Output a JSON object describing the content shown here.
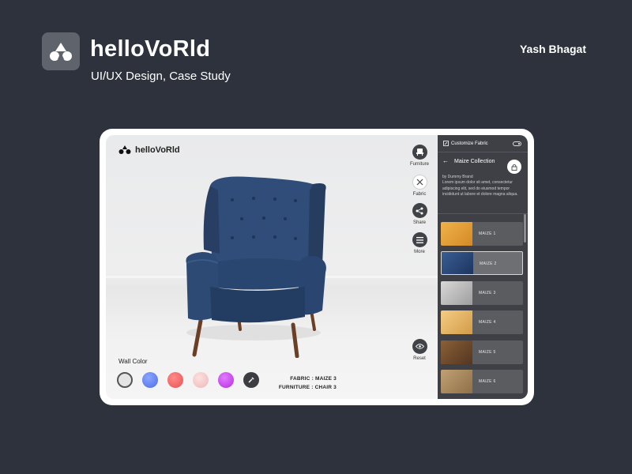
{
  "header": {
    "title": "helloVoRld",
    "subtitle": "UI/UX Design, Case Study",
    "author": "Yash Bhagat"
  },
  "app": {
    "logo_text": "helloVoRld",
    "tools": [
      {
        "label": "Furniture",
        "icon": "chair-icon"
      },
      {
        "label": "Fabric",
        "icon": "close-icon"
      },
      {
        "label": "Share",
        "icon": "share-icon"
      },
      {
        "label": "More",
        "icon": "menu-icon"
      }
    ],
    "reset_label": "Reset",
    "wall_color_label": "Wall Color",
    "wall_colors": [
      "#e4e4e4",
      "#5b7ff0",
      "#f06464",
      "#f2c8c8",
      "#c23fe6"
    ],
    "fabric_info": "FABRIC : MAIZE 3",
    "furniture_info": "FURNITURE : CHAIR 3"
  },
  "panel": {
    "title": "Customize Fabric",
    "collection": "Maize Collection",
    "brand": "by Dummy Brand",
    "description": "Lorem ipsum dolor sit amet, consectetur adipiscing elit, sed do eiusmod tempor incididunt ut labore et dolore magna aliqua.",
    "fabrics": [
      {
        "label": "MAIZE 1",
        "color": "#e6a33d"
      },
      {
        "label": "MAIZE 2",
        "color": "#2b4a7c",
        "selected": true
      },
      {
        "label": "MAIZE 3",
        "color": "#bdbdbd"
      },
      {
        "label": "MAIZE 4",
        "color": "#e8b76b"
      },
      {
        "label": "MAIZE 5",
        "color": "#6e4a2c"
      },
      {
        "label": "MAIZE 6",
        "color": "#a8875f"
      }
    ]
  },
  "colors": {
    "background": "#2e323c",
    "panel": "#3e4045",
    "chair": "#2d4a72"
  }
}
